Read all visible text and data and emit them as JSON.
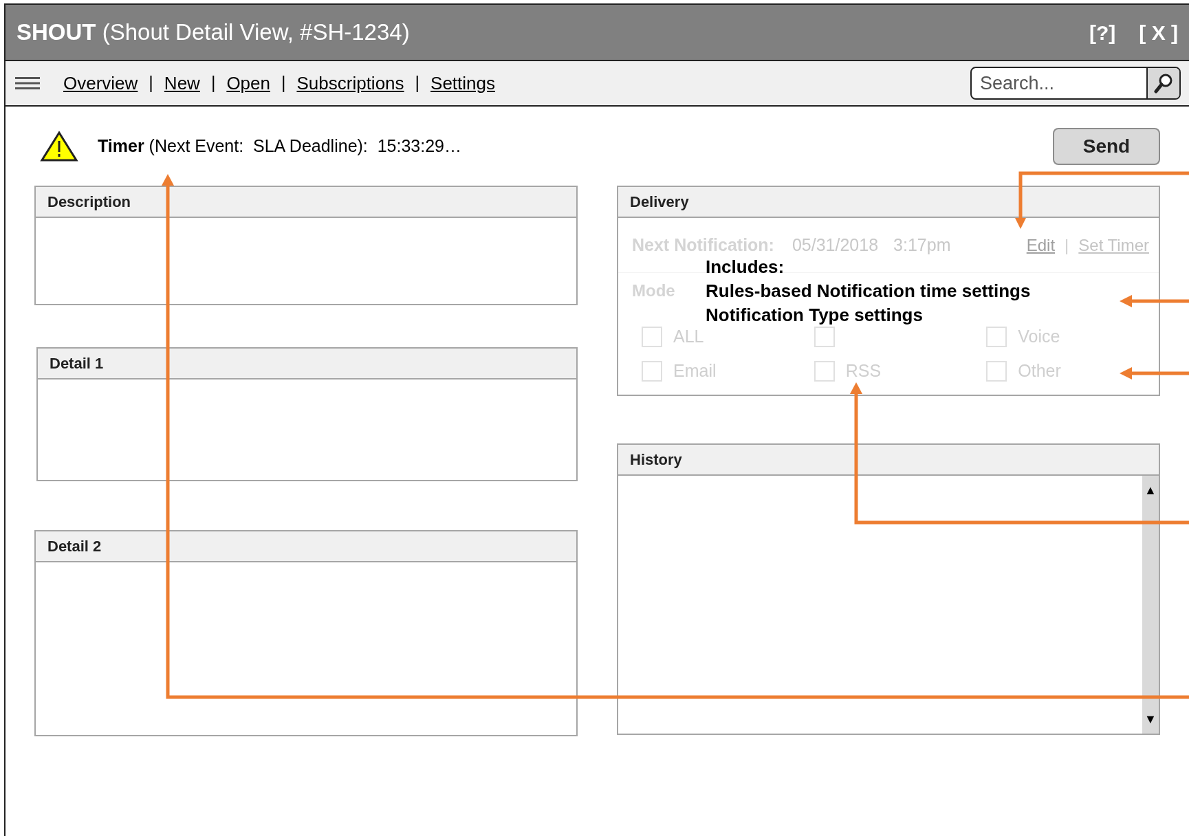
{
  "window": {
    "title_bold": "SHOUT",
    "title": "(Shout Detail View, #SH-1234)",
    "help": "[?]",
    "close": "[ X ]"
  },
  "nav": {
    "separator": "|",
    "items": [
      {
        "label": "Overview"
      },
      {
        "label": "New"
      },
      {
        "label": "Open"
      },
      {
        "label": "Subscriptions"
      },
      {
        "label": "Settings"
      }
    ]
  },
  "search": {
    "placeholder": "Search..."
  },
  "timer": {
    "label": "Timer",
    "text": "(Next Event:  SLA Deadline):  15:33:29…"
  },
  "send_button": "Send",
  "left_panels": [
    {
      "title": "Description"
    },
    {
      "title": "Detail 1"
    },
    {
      "title": "Detail 2"
    }
  ],
  "delivery": {
    "title": "Delivery",
    "disabled": true,
    "next_label": "Next Notification:",
    "date": "05/31/2018",
    "time": "3:17pm",
    "link_separator": "|",
    "links": [
      {
        "label": "Edit",
        "disabled": false
      },
      {
        "label": "Set Timer",
        "disabled": true
      }
    ],
    "mode_label": "Mode",
    "options": [
      {
        "label": "ALL",
        "checked": false
      },
      {
        "checked": false
      },
      {
        "label": "Voice",
        "checked": false
      },
      {
        "label": "Email",
        "checked": false
      },
      {
        "label": "RSS",
        "checked": false
      },
      {
        "label": "Other",
        "checked": false
      }
    ]
  },
  "history": {
    "title": "History",
    "scroll_up": "▲",
    "scroll_down": "▼"
  },
  "annotation": {
    "lines": [
      "Includes:",
      "Rules-based Notification time settings",
      "Notification Type settings"
    ]
  }
}
